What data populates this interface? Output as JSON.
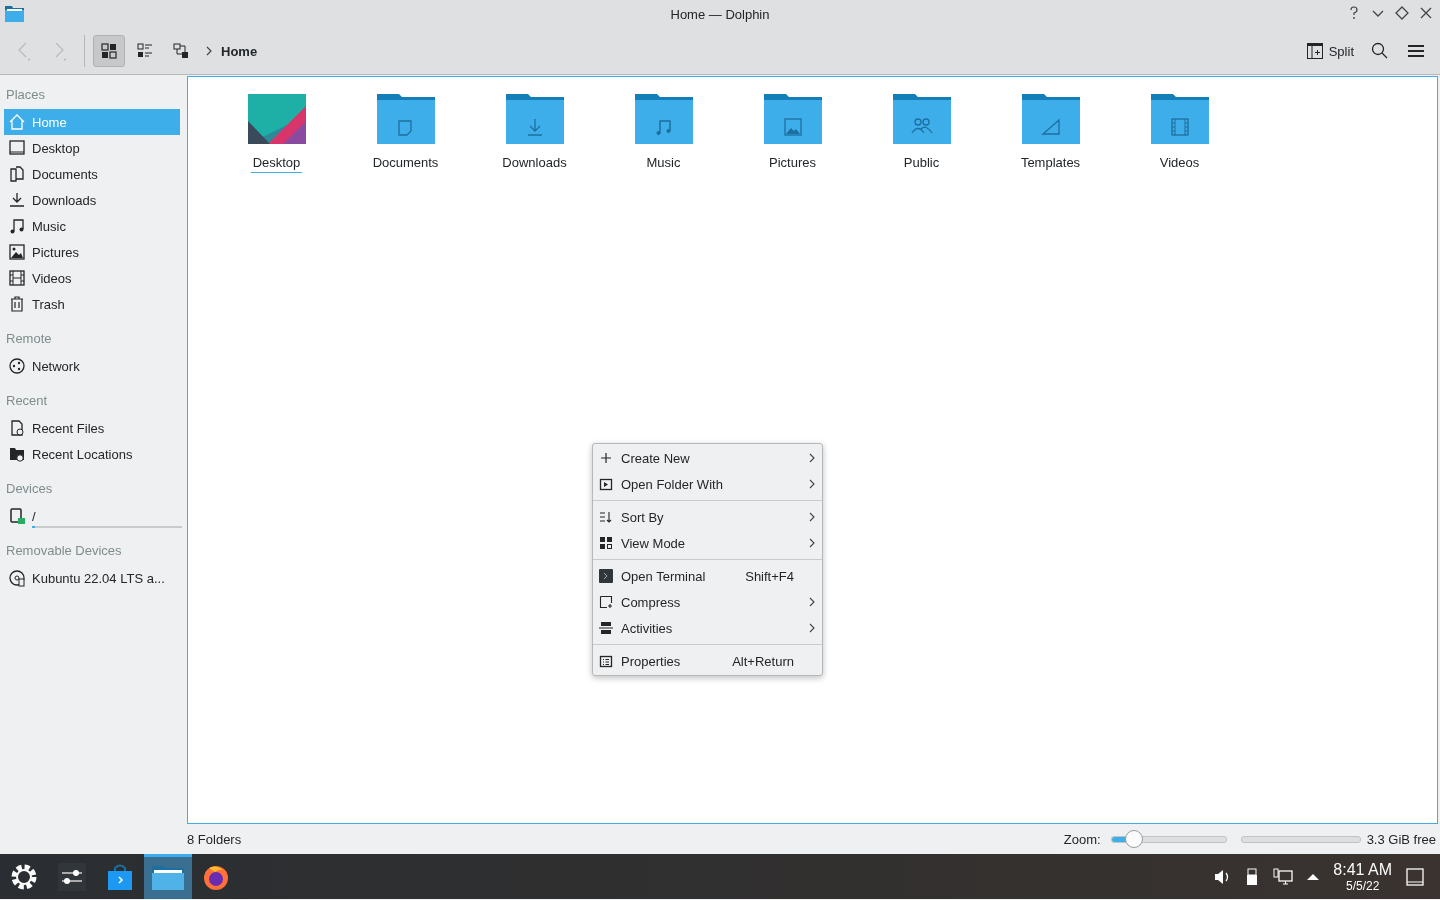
{
  "window": {
    "title": "Home — Dolphin"
  },
  "toolbar": {
    "view_modes": [
      {
        "selected": true
      },
      {
        "selected": false
      },
      {
        "selected": false
      }
    ],
    "breadcrumb": "Home",
    "split": "Split"
  },
  "sidebar": [
    {
      "title": "Places",
      "items": [
        {
          "label": "Home",
          "selected": true
        },
        {
          "label": "Desktop",
          "selected": false
        },
        {
          "label": "Documents",
          "selected": false
        },
        {
          "label": "Downloads",
          "selected": false
        },
        {
          "label": "Music",
          "selected": false
        },
        {
          "label": "Pictures",
          "selected": false
        },
        {
          "label": "Videos",
          "selected": false
        },
        {
          "label": "Trash",
          "selected": false
        }
      ]
    },
    {
      "title": "Remote",
      "items": [
        {
          "label": "Network",
          "selected": false
        }
      ]
    },
    {
      "title": "Recent",
      "items": [
        {
          "label": "Recent Files",
          "selected": false
        },
        {
          "label": "Recent Locations",
          "selected": false
        }
      ]
    },
    {
      "title": "Devices",
      "items": [
        {
          "label": "/",
          "selected": false,
          "level": 0.02
        }
      ]
    },
    {
      "title": "Removable Devices",
      "items": [
        {
          "label": "Kubuntu 22.04 LTS a...",
          "selected": false
        }
      ]
    }
  ],
  "folders": [
    {
      "name": "Desktop",
      "kind": "preview",
      "focused": true
    },
    {
      "name": "Documents",
      "kind": "folder",
      "focused": false
    },
    {
      "name": "Downloads",
      "kind": "folder",
      "focused": false
    },
    {
      "name": "Music",
      "kind": "folder",
      "focused": false
    },
    {
      "name": "Pictures",
      "kind": "folder",
      "focused": false
    },
    {
      "name": "Public",
      "kind": "folder",
      "focused": false
    },
    {
      "name": "Templates",
      "kind": "folder",
      "focused": false
    },
    {
      "name": "Videos",
      "kind": "folder",
      "focused": false
    }
  ],
  "context_menu": [
    {
      "kind": "item",
      "label": "Create New",
      "submenu": true
    },
    {
      "kind": "item",
      "label": "Open Folder With",
      "submenu": true
    },
    {
      "kind": "separator"
    },
    {
      "kind": "item",
      "label": "Sort By",
      "submenu": true
    },
    {
      "kind": "item",
      "label": "View Mode",
      "submenu": true
    },
    {
      "kind": "separator"
    },
    {
      "kind": "item",
      "label": "Open Terminal",
      "shortcut": "Shift+F4",
      "submenu": false
    },
    {
      "kind": "item",
      "label": "Compress",
      "submenu": true
    },
    {
      "kind": "item",
      "label": "Activities",
      "submenu": true
    },
    {
      "kind": "separator"
    },
    {
      "kind": "item",
      "label": "Properties",
      "shortcut": "Alt+Return",
      "submenu": false
    }
  ],
  "status_bar": {
    "summary": "8 Folders",
    "zoom_label": "Zoom:",
    "zoom": {
      "level": 0.2
    },
    "space": {
      "level": 0.0
    },
    "free": "3.3 GiB free"
  },
  "taskbar": {
    "apps": [
      {
        "active": false
      },
      {
        "active": false
      },
      {
        "active": true
      },
      {
        "active": false
      }
    ],
    "time": "8:41 AM",
    "date": "5/5/22"
  }
}
